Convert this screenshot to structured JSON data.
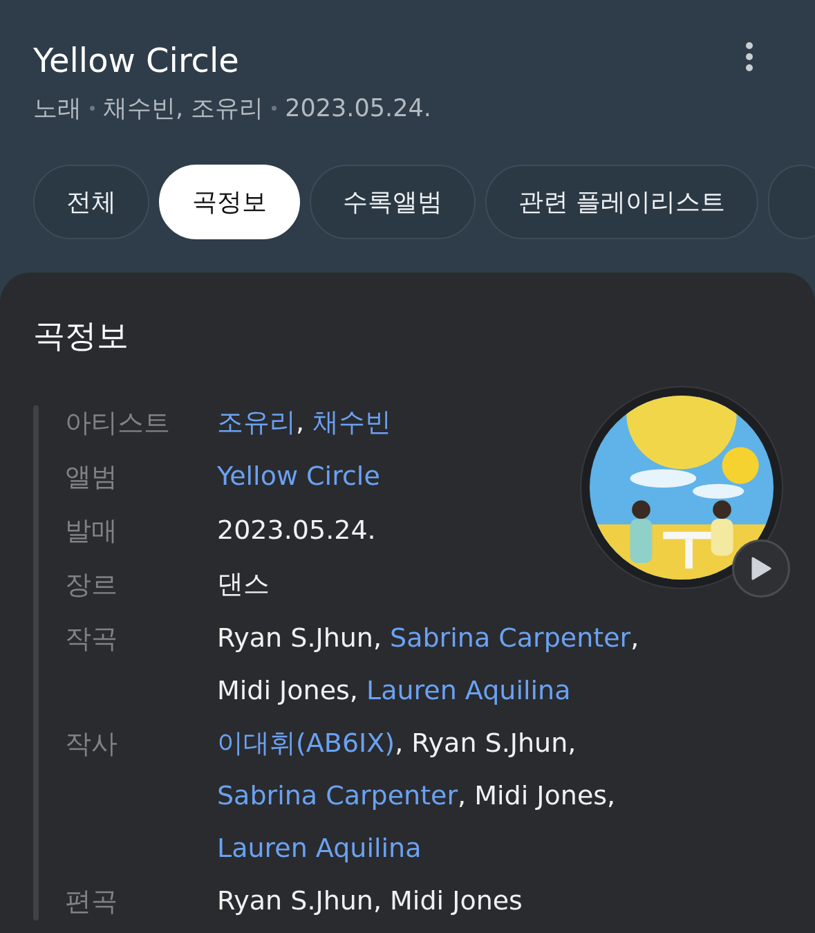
{
  "header": {
    "title": "Yellow Circle",
    "meta": [
      "노래",
      "채수빈, 조유리",
      "2023.05.24."
    ]
  },
  "tabs": [
    {
      "label": "전체",
      "selected": false
    },
    {
      "label": "곡정보",
      "selected": true
    },
    {
      "label": "수록앨범",
      "selected": false
    },
    {
      "label": "관련 플레이리스트",
      "selected": false
    }
  ],
  "card": {
    "title": "곡정보",
    "rows": [
      {
        "label": "아티스트",
        "value": [
          {
            "text": "조유리",
            "link": true
          },
          {
            "text": ", ",
            "link": false
          },
          {
            "text": "채수빈",
            "link": true
          }
        ]
      },
      {
        "label": "앨범",
        "value": [
          {
            "text": "Yellow Circle",
            "link": true
          }
        ]
      },
      {
        "label": "발매",
        "value": [
          {
            "text": "2023.05.24.",
            "link": false
          }
        ]
      },
      {
        "label": "장르",
        "value": [
          {
            "text": "댄스",
            "link": false
          }
        ]
      },
      {
        "label": "작곡",
        "value": [
          {
            "text": "Ryan S.Jhun, ",
            "link": false
          },
          {
            "text": "Sabrina Carpenter",
            "link": true
          },
          {
            "text": ", ",
            "link": false
          },
          {
            "text": "Midi Jones, ",
            "link": false
          },
          {
            "text": "Lauren Aquilina",
            "link": true
          }
        ]
      },
      {
        "label": "작사",
        "value": [
          {
            "text": "이대휘(AB6IX)",
            "link": true
          },
          {
            "text": ", Ryan S.Jhun, ",
            "link": false
          },
          {
            "text": "Sabrina Carpenter",
            "link": true
          },
          {
            "text": ", ",
            "link": false
          },
          {
            "text": "Midi Jones, ",
            "link": false
          },
          {
            "text": "Lauren Aquilina",
            "link": true
          }
        ]
      },
      {
        "label": "편곡",
        "value": [
          {
            "text": "Ryan S.Jhun, Midi Jones",
            "link": false
          }
        ]
      }
    ]
  }
}
